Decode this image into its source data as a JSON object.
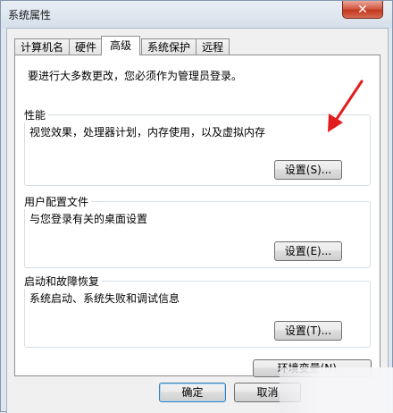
{
  "window": {
    "title": "系统属性",
    "close_glyph": "✕"
  },
  "tabs": [
    {
      "label": "计算机名"
    },
    {
      "label": "硬件"
    },
    {
      "label": "高级",
      "active": true
    },
    {
      "label": "系统保护"
    },
    {
      "label": "远程"
    }
  ],
  "admin_note": "要进行大多数更改，您必须作为管理员登录。",
  "performance": {
    "title": "性能",
    "description": "视觉效果，处理器计划，内存使用，以及虚拟内存",
    "button": "设置(S)..."
  },
  "user_profiles": {
    "title": "用户配置文件",
    "description": "与您登录有关的桌面设置",
    "button": "设置(E)..."
  },
  "startup_recovery": {
    "title": "启动和故障恢复",
    "description": "系统启动、系统失败和调试信息",
    "button": "设置(T)..."
  },
  "env_button": "环境变量(N)...",
  "footer": {
    "ok": "确定",
    "cancel": "取消"
  },
  "colors": {
    "annotation_arrow": "#e21d1d",
    "close_button": "#c2391f"
  },
  "icons": {
    "close": "close-icon",
    "arrow": "annotation-arrow"
  }
}
